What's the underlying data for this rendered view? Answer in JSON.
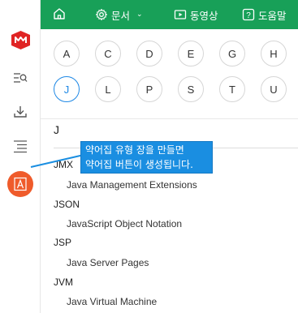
{
  "topbar": {
    "doc_label": "문서",
    "video_label": "동영상",
    "help_label": "도움말",
    "color": "#18a058"
  },
  "sidebar": {
    "icons": [
      "logo-icon",
      "search-list-icon",
      "download-icon",
      "outline-icon",
      "abbreviation-icon"
    ],
    "active_color": "#ef5b2b"
  },
  "alphabet": {
    "row1": [
      "A",
      "C",
      "D",
      "E",
      "G",
      "H"
    ],
    "row2": [
      "J",
      "L",
      "P",
      "S",
      "T",
      "U"
    ],
    "selected": "J"
  },
  "section": {
    "letter": "J",
    "entries": [
      {
        "term": "JMX",
        "description": "Java Management Extensions"
      },
      {
        "term": "JSON",
        "description": "JavaScript Object Notation"
      },
      {
        "term": "JSP",
        "description": "Java Server Pages"
      },
      {
        "term": "JVM",
        "description": "Java Virtual Machine"
      }
    ]
  },
  "tooltip": {
    "line1": "약어집 유형 장을 만들면",
    "line2": "약어집 버튼이 생성됩니다."
  }
}
